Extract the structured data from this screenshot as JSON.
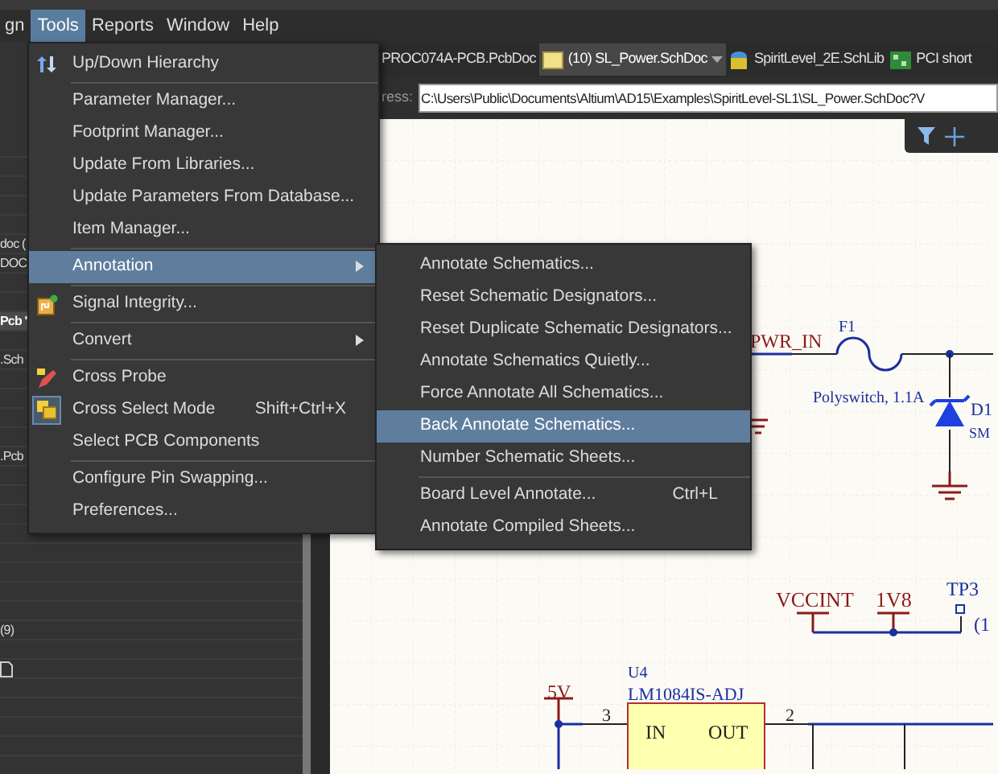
{
  "menu_bar": [
    {
      "label": "gn",
      "selected": false
    },
    {
      "label": "Tools",
      "selected": true
    },
    {
      "label": "Reports",
      "selected": false
    },
    {
      "label": "Window",
      "selected": false
    },
    {
      "label": "Help",
      "selected": false
    }
  ],
  "panel": {
    "rows": [
      {
        "text": "doc (",
        "selected": false
      },
      {
        "text": "DOC",
        "selected": false
      },
      {
        "text": "Pcb '",
        "selected": true
      },
      {
        "text": ".Sch",
        "selected": false
      },
      {
        "text": ".Pcb",
        "selected": false
      },
      {
        "text": "(9)",
        "selected": false
      }
    ]
  },
  "tabs": [
    {
      "label": "PROC074A-PCB.PcbDoc",
      "selected": false
    },
    {
      "label": "(10) SL_Power.SchDoc",
      "selected": true
    },
    {
      "label": "SpiritLevel_2E.SchLib",
      "selected": false
    },
    {
      "label": "PCI short",
      "selected": false
    }
  ],
  "address": {
    "label": "ress:",
    "value": "C:\\Users\\Public\\Documents\\Altium\\AD15\\Examples\\SpiritLevel-SL1\\SL_Power.SchDoc?V"
  },
  "schematic": {
    "labels": [
      "PWR_IN",
      "F1",
      "Polyswitch, 1.1A",
      "D1",
      "SM",
      "VCCINT",
      "1V8",
      "TP3",
      "(1",
      "U4",
      "LM1084IS-ADJ",
      "5V",
      "3",
      "IN",
      "OUT",
      "2"
    ]
  },
  "tools_menu": [
    {
      "kind": "item",
      "label": "Up/Down Hierarchy",
      "submenu": false,
      "selected": false,
      "checked": false
    },
    {
      "kind": "separator"
    },
    {
      "kind": "item",
      "label": "Parameter Manager...",
      "submenu": false,
      "selected": false,
      "checked": false
    },
    {
      "kind": "item",
      "label": "Footprint Manager...",
      "submenu": false,
      "selected": false,
      "checked": false
    },
    {
      "kind": "item",
      "label": "Update From Libraries...",
      "submenu": false,
      "selected": false,
      "checked": false
    },
    {
      "kind": "item",
      "label": "Update Parameters From Database...",
      "submenu": false,
      "selected": false,
      "checked": false
    },
    {
      "kind": "item",
      "label": "Item Manager...",
      "submenu": false,
      "selected": false,
      "checked": false
    },
    {
      "kind": "separator"
    },
    {
      "kind": "item",
      "label": "Annotation",
      "submenu": true,
      "selected": true,
      "checked": false
    },
    {
      "kind": "separator"
    },
    {
      "kind": "item",
      "label": "Signal Integrity...",
      "submenu": false,
      "selected": false,
      "checked": false
    },
    {
      "kind": "separator"
    },
    {
      "kind": "item",
      "label": "Convert",
      "submenu": true,
      "selected": false,
      "checked": false
    },
    {
      "kind": "separator"
    },
    {
      "kind": "item",
      "label": "Cross Probe",
      "submenu": false,
      "selected": false,
      "checked": false
    },
    {
      "kind": "item",
      "label": "Cross Select Mode",
      "shortcut": "Shift+Ctrl+X",
      "submenu": false,
      "selected": false,
      "checked": true
    },
    {
      "kind": "item",
      "label": "Select PCB Components",
      "submenu": false,
      "selected": false,
      "checked": false
    },
    {
      "kind": "separator"
    },
    {
      "kind": "item",
      "label": "Configure Pin Swapping...",
      "submenu": false,
      "selected": false,
      "checked": false
    },
    {
      "kind": "item",
      "label": "Preferences...",
      "submenu": false,
      "selected": false,
      "checked": false
    }
  ],
  "annotation_menu": [
    {
      "kind": "item",
      "label": "Annotate Schematics...",
      "selected": false
    },
    {
      "kind": "item",
      "label": "Reset Schematic Designators...",
      "selected": false
    },
    {
      "kind": "item",
      "label": "Reset Duplicate Schematic Designators...",
      "selected": false
    },
    {
      "kind": "item",
      "label": "Annotate Schematics Quietly...",
      "selected": false
    },
    {
      "kind": "item",
      "label": "Force Annotate All Schematics...",
      "selected": false
    },
    {
      "kind": "item",
      "label": "Back Annotate Schematics...",
      "selected": true
    },
    {
      "kind": "item",
      "label": "Number Schematic Sheets...",
      "selected": false
    },
    {
      "kind": "separator"
    },
    {
      "kind": "item",
      "label": "Board Level Annotate...",
      "shortcut": "Ctrl+L",
      "selected": false
    },
    {
      "kind": "item",
      "label": "Annotate Compiled Sheets...",
      "selected": false
    }
  ]
}
